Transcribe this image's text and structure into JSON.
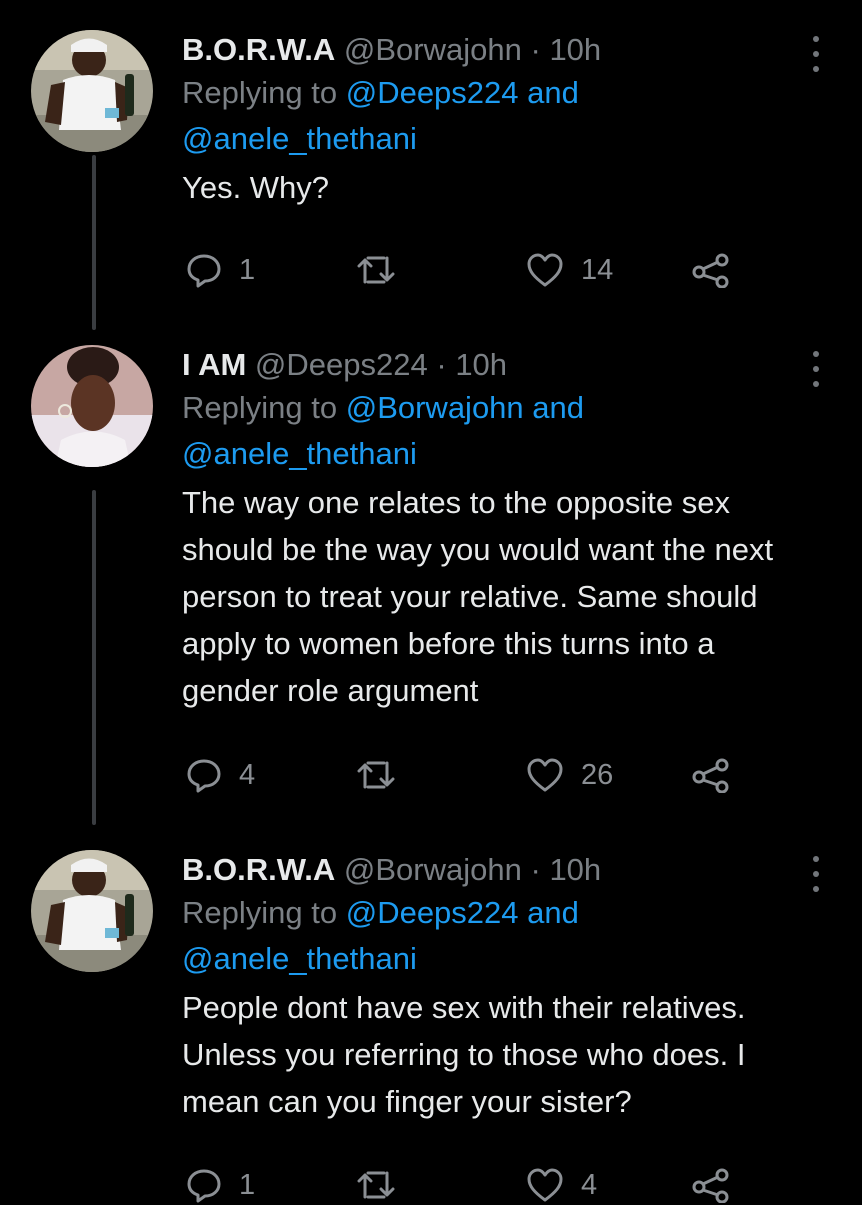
{
  "tweets": [
    {
      "name": "B.O.R.W.A",
      "handle": "@Borwajohn",
      "time": "10h",
      "replying_to_label": "Replying to",
      "replying_to_first": "@Deeps224",
      "replying_to_and": "and",
      "replying_to_second": "@anele_thethani",
      "text": "Yes. Why?",
      "replies": "1",
      "likes": "14"
    },
    {
      "name": "I AM",
      "handle": "@Deeps224",
      "time": "10h",
      "replying_to_label": "Replying to",
      "replying_to_first": "@Borwajohn",
      "replying_to_and": "and",
      "replying_to_second": "@anele_thethani",
      "text": "The way one relates to the opposite sex should be the way you would want the next person to treat your relative. Same should apply to women before this turns into a gender role argument",
      "replies": "4",
      "likes": "26"
    },
    {
      "name": "B.O.R.W.A",
      "handle": "@Borwajohn",
      "time": "10h",
      "replying_to_label": "Replying to",
      "replying_to_first": "@Deeps224",
      "replying_to_and": "and",
      "replying_to_second": "@anele_thethani",
      "text": "People dont have sex with their relatives. Unless you referring to those who does. I mean can you finger your sister?",
      "replies": "1",
      "likes": "4"
    }
  ],
  "icons": [
    "reply-icon",
    "retweet-icon",
    "like-icon",
    "share-icon",
    "more-options-icon"
  ],
  "colors": {
    "background": "#000000",
    "text": "#e7e9ea",
    "muted": "#7b8085",
    "link": "#1d9bf0"
  },
  "separator": "·"
}
